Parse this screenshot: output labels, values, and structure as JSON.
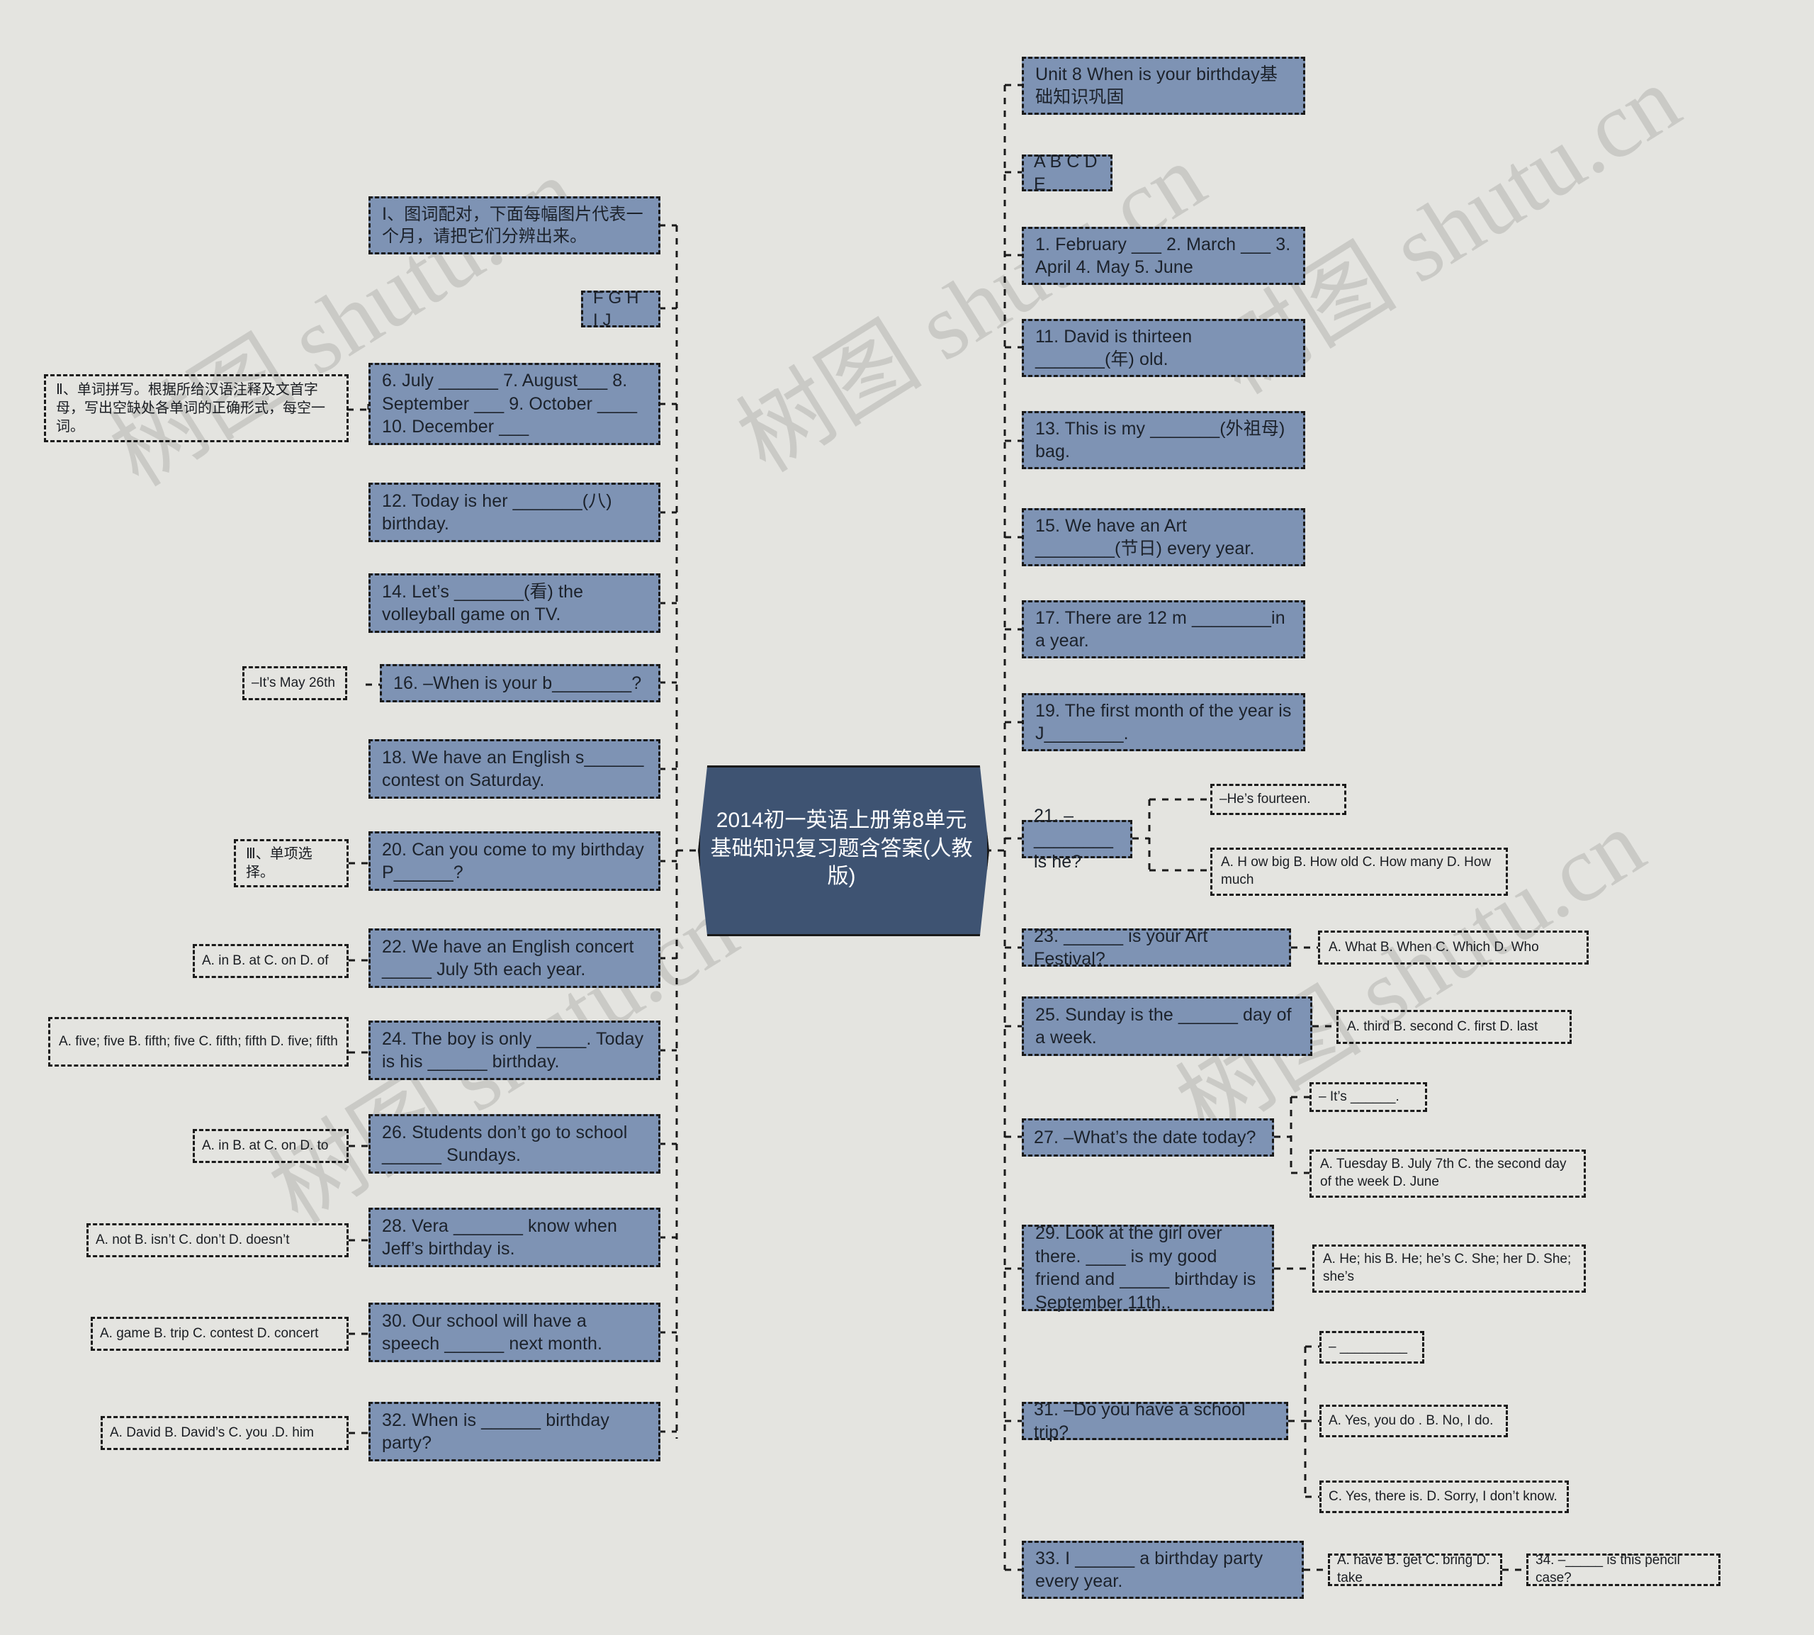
{
  "meta": {
    "colors": {
      "background": "#e4e4e0",
      "node_fill": "#7e93b4",
      "node_border": "#1a1a1a",
      "root_fill": "#3e5372",
      "root_text": "#ffffff",
      "text": "#1c222b",
      "watermark": "rgba(150,150,145,.33)"
    },
    "watermark_text": "树图 shutu.cn"
  },
  "root": {
    "title": "2014初一英语上册第8单元基础知识复习题含答案(人教版)"
  },
  "left_branch": {
    "sections": [
      {
        "id": "section-1",
        "label": "Ⅰ、图词配对，下面每幅图片代表一个月，请把它们分辨出来。"
      },
      {
        "id": "section-2",
        "label": "Ⅱ、单词拼写。根据所给汉语注释及文首字母，写出空缺处各单词的正确形式，每空一词。"
      },
      {
        "id": "section-3",
        "label": "Ⅲ、单项选择。"
      }
    ],
    "nodes": [
      {
        "id": "l-instr-1",
        "text": "Ⅰ、图词配对，下面每幅图片代表一个月，请把它们分辨出来。"
      },
      {
        "id": "l-fghij",
        "text": "F G H I J"
      },
      {
        "id": "l-q6",
        "text": "6. July ______  7. August___  8. September ___  9. October ____  10. December ___"
      },
      {
        "id": "l-q12",
        "text": "12. Today is her _______(八) birthday."
      },
      {
        "id": "l-q14",
        "text": "14. Let’s _______(看) the volleyball game on TV."
      },
      {
        "id": "l-q16",
        "text": "16. –When is your b________?"
      },
      {
        "id": "l-q18",
        "text": "18. We have an English s______ contest on Saturday."
      },
      {
        "id": "l-q20",
        "text": "20. Can you come to my birthday P______?"
      },
      {
        "id": "l-q22",
        "text": "22. We have an English concert _____ July 5th each year."
      },
      {
        "id": "l-q24",
        "text": "24. The boy is only _____. Today is his ______ birthday."
      },
      {
        "id": "l-q26",
        "text": "26. Students don’t go to school ______ Sundays."
      },
      {
        "id": "l-q28",
        "text": "28. Vera _______ know when Jeff’s birthday is."
      },
      {
        "id": "l-q30",
        "text": "30. Our school will have a speech ______ next month."
      },
      {
        "id": "l-q32",
        "text": "32. When is ______ birthday party?"
      }
    ],
    "leaves": [
      {
        "id": "l-a16",
        "text": "–It’s May 26th"
      },
      {
        "id": "l-a22",
        "text": "A. in B. at C. on D. of"
      },
      {
        "id": "l-a24",
        "text": "A. five; five B. fifth; five C. fifth; fifth D. five; fifth"
      },
      {
        "id": "l-a26",
        "text": "A. in B. at C. on D. to"
      },
      {
        "id": "l-a28",
        "text": "A. not B. isn’t C. don’t D. doesn’t"
      },
      {
        "id": "l-a30",
        "text": "A. game B. trip C. contest D. concert"
      },
      {
        "id": "l-a32",
        "text": "A. David B. David’s C. you .D. him"
      }
    ]
  },
  "right_branch": {
    "nodes": [
      {
        "id": "r-title",
        "text": "Unit 8 When is your birthday基础知识巩固"
      },
      {
        "id": "r-abcde",
        "text": "A B C D E"
      },
      {
        "id": "r-q1",
        "text": "1. February ___  2. March ___  3. April 4. May 5. June"
      },
      {
        "id": "r-q11",
        "text": "11. David is thirteen _______(年) old."
      },
      {
        "id": "r-q13",
        "text": "13. This is my _______(外祖母) bag."
      },
      {
        "id": "r-q15",
        "text": "15. We have an Art ________(节日) every year."
      },
      {
        "id": "r-q17",
        "text": "17. There are 12 m ________in a year."
      },
      {
        "id": "r-q19",
        "text": "19. The first month of the year is J________."
      },
      {
        "id": "r-q21",
        "text": "21. –________ is he?"
      },
      {
        "id": "r-q23",
        "text": "23. ______ is your Art Festival?"
      },
      {
        "id": "r-q25",
        "text": "25. Sunday is the ______ day of a week."
      },
      {
        "id": "r-q27",
        "text": "27. –What’s the date today?"
      },
      {
        "id": "r-q29",
        "text": "29. Look at the girl over there. ____ is my good friend and _____ birthday is September 11th.."
      },
      {
        "id": "r-q31",
        "text": "31. –Do you have a school trip?"
      },
      {
        "id": "r-q33",
        "text": "33. I ______ a birthday party every year."
      }
    ],
    "leaves": [
      {
        "id": "r-a21a",
        "text": "–He’s fourteen."
      },
      {
        "id": "r-a21b",
        "text": "A. H ow big B. How old C. How many D. How much"
      },
      {
        "id": "r-a23",
        "text": "A. What B. When C. Which D. Who"
      },
      {
        "id": "r-a25",
        "text": "A. third B. second C. first D. last"
      },
      {
        "id": "r-a27a",
        "text": "– It’s ______."
      },
      {
        "id": "r-a27b",
        "text": "A. Tuesday B. July 7th C. the second day of the week D. June"
      },
      {
        "id": "r-a29",
        "text": "A. He; his B. He; he’s C. She; her D. She; she’s"
      },
      {
        "id": "r-a31a",
        "text": "– _________"
      },
      {
        "id": "r-a31b",
        "text": "A. Yes, you do . B. No, I do."
      },
      {
        "id": "r-a31c",
        "text": "C. Yes, there is. D. Sorry, I don’t know."
      },
      {
        "id": "r-a33",
        "text": "A. have B. get C. bring D. take"
      },
      {
        "id": "r-a34",
        "text": "34. –_____ is this pencil case?"
      }
    ]
  }
}
